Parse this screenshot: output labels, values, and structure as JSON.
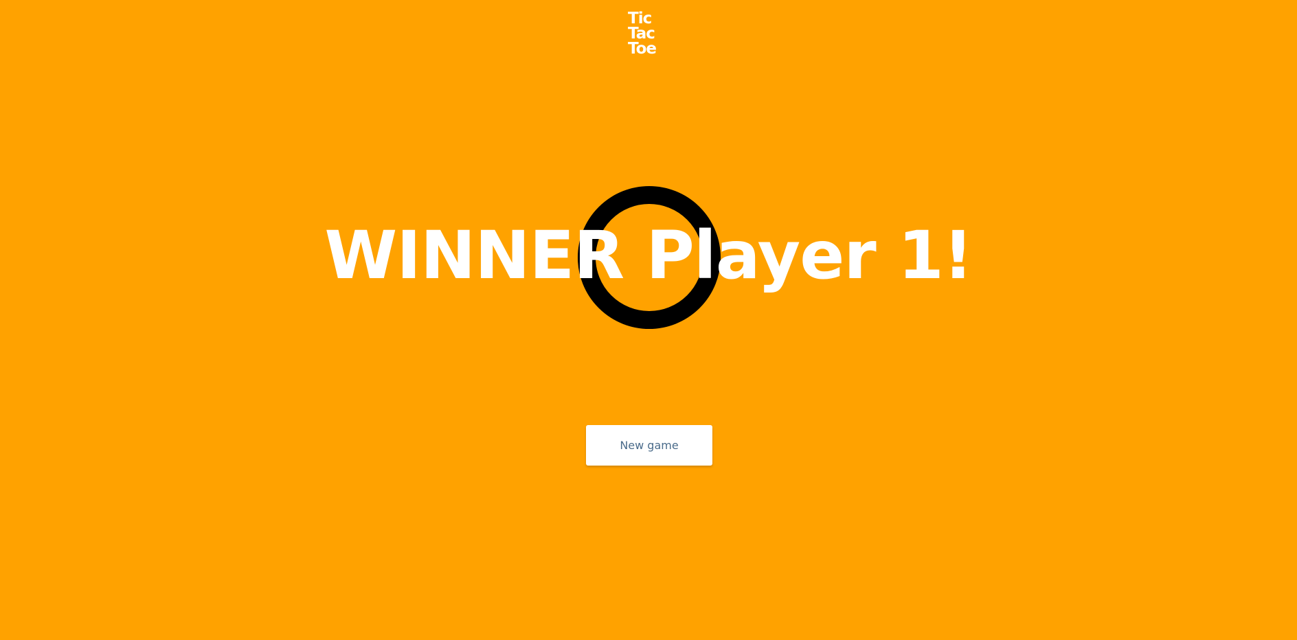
{
  "logo": {
    "line1": "Tic",
    "line2": "Tac",
    "line3": "Toe"
  },
  "result": {
    "headline": "WINNER Player 1!",
    "winning_mark": "O",
    "mark_icon": "circle-o-icon"
  },
  "actions": {
    "new_game_label": "New game"
  },
  "colors": {
    "background": "#ffa200",
    "text": "#ffffff",
    "mark": "#000000",
    "button_bg": "#ffffff",
    "button_text": "#4a6b8a"
  }
}
